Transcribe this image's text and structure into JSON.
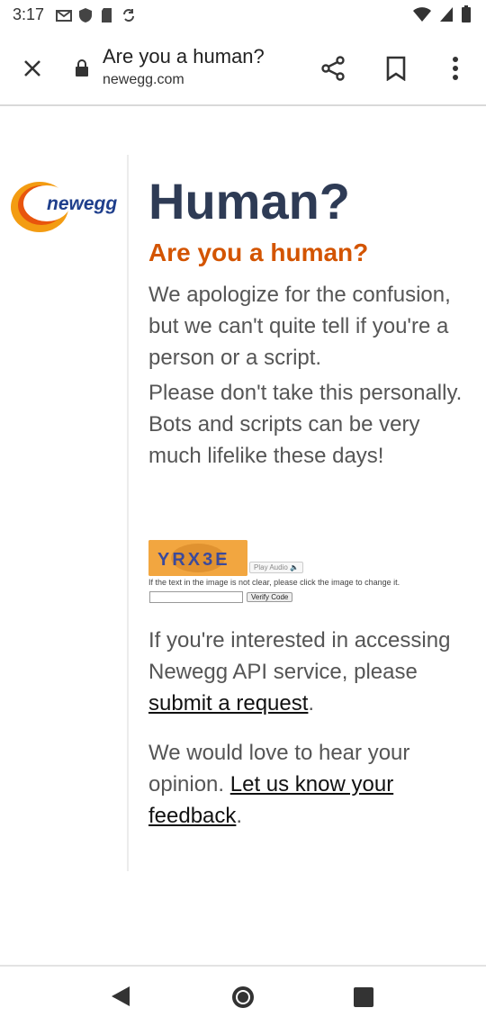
{
  "status_bar": {
    "time": "3:17"
  },
  "browser": {
    "page_title": "Are you a human?",
    "url": "newegg.com"
  },
  "logo": {
    "text": "newegg"
  },
  "content": {
    "heading": "Human?",
    "subheading": "Are you a human?",
    "paragraph1": "We apologize for the confusion, but we can't quite tell if you're a person or a script.",
    "paragraph2": "Please don't take this personally. Bots and scripts can be very much lifelike these days!",
    "captcha_text": "YRX3E",
    "captcha_audio_label": "Play Audio",
    "captcha_help": "If the text in the image is not clear, please click the image to change it.",
    "verify_label": "Verify Code",
    "api_text_before": "If you're interested in accessing Newegg API service, please ",
    "api_link": "submit a request",
    "api_text_after": ".",
    "feedback_text_before": "We would love to hear your opinion. ",
    "feedback_link": "Let us know your feedback",
    "feedback_text_after": "."
  },
  "colors": {
    "heading": "#2e3b55",
    "subheading": "#d35400",
    "body_text": "#555555"
  },
  "icons": [
    "close-icon",
    "lock-icon",
    "share-icon",
    "bookmark-icon",
    "more-vert-icon",
    "back-icon",
    "home-icon",
    "recents-icon"
  ]
}
